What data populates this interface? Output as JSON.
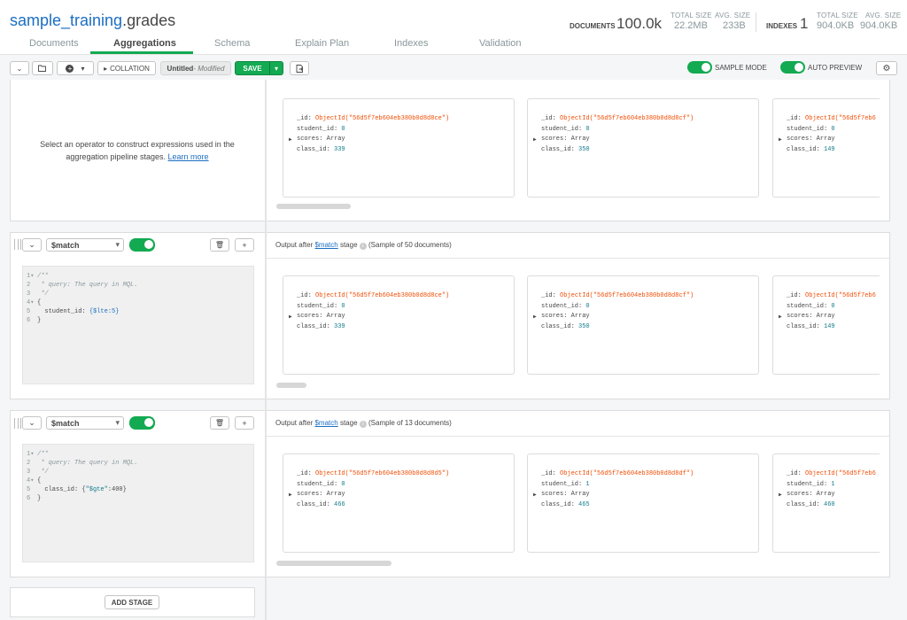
{
  "header": {
    "db": "sample_training",
    "collection": ".grades",
    "documents_label": "DOCUMENTS",
    "documents_value": "100.0k",
    "total_size_label": "TOTAL SIZE",
    "total_size_value": "22.2MB",
    "avg_size_label": "AVG. SIZE",
    "avg_size_value": "233B",
    "indexes_label": "INDEXES",
    "indexes_value": "1",
    "idx_total_size_label": "TOTAL SIZE",
    "idx_total_size_value": "904.0KB",
    "idx_avg_size_label": "AVG. SIZE",
    "idx_avg_size_value": "904.0KB"
  },
  "tabs": [
    "Documents",
    "Aggregations",
    "Schema",
    "Explain Plan",
    "Indexes",
    "Validation"
  ],
  "toolbar": {
    "collation": "COLLATION",
    "pipeline_name": "Untitled",
    "modified": "- Modified",
    "save": "SAVE",
    "sample_mode": "SAMPLE MODE",
    "auto_preview": "AUTO PREVIEW"
  },
  "first_stage": {
    "help": "Select an operator to construct expressions used in the aggregation pipeline stages.",
    "learn_more": "Learn more",
    "docs": [
      {
        "id": "ObjectId(\"56d5f7eb604eb380b0d8d8ce\")",
        "student_id": "0",
        "scores": "Array",
        "class_id": "339"
      },
      {
        "id": "ObjectId(\"56d5f7eb604eb380b0d8d8cf\")",
        "student_id": "0",
        "scores": "Array",
        "class_id": "350"
      },
      {
        "id": "ObjectId(\"56d5f7eb6",
        "student_id": "0",
        "scores": "Array",
        "class_id": "149"
      }
    ]
  },
  "stages": [
    {
      "operator": "$match",
      "output_prefix": "Output after",
      "output_op": "$match",
      "output_suffix": "stage",
      "sample": "(Sample of 50 documents)",
      "code": {
        "l1": "/**",
        "l2": " * query: The query in MQL.",
        "l3": " */",
        "l4": "{",
        "l5_key": "  student_id: ",
        "l5_val": "{$lte:5}",
        "l6": "}"
      },
      "docs": [
        {
          "id": "ObjectId(\"56d5f7eb604eb380b0d8d8ce\")",
          "student_id": "0",
          "scores": "Array",
          "class_id": "339"
        },
        {
          "id": "ObjectId(\"56d5f7eb604eb380b0d8d8cf\")",
          "student_id": "0",
          "scores": "Array",
          "class_id": "350"
        },
        {
          "id": "ObjectId(\"56d5f7eb6",
          "student_id": "0",
          "scores": "Array",
          "class_id": "149"
        }
      ]
    },
    {
      "operator": "$match",
      "output_prefix": "Output after",
      "output_op": "$match",
      "output_suffix": "stage",
      "sample": "(Sample of 13 documents)",
      "code": {
        "l1": "/**",
        "l2": " * query: The query in MQL.",
        "l3": " */",
        "l4": "{",
        "l5_key": "  class_id: {",
        "l5_val": "\"$gte\"",
        "l5_rest": ":400}",
        "l6": "}"
      },
      "docs": [
        {
          "id": "ObjectId(\"56d5f7eb604eb380b0d8d8d5\")",
          "student_id": "0",
          "scores": "Array",
          "class_id": "466"
        },
        {
          "id": "ObjectId(\"56d5f7eb604eb380b0d8d8df\")",
          "student_id": "1",
          "scores": "Array",
          "class_id": "465"
        },
        {
          "id": "ObjectId(\"56d5f7eb6",
          "student_id": "1",
          "scores": "Array",
          "class_id": "460"
        }
      ]
    }
  ],
  "add_stage": "ADD STAGE",
  "field_labels": {
    "id": "_id",
    "student_id": "student_id",
    "scores": "scores",
    "class_id": "class_id"
  },
  "colors": {
    "accent": "#13aa52",
    "link": "#1b6ec2",
    "oid": "#f04d05"
  },
  "icons": [
    "chevron-down-icon",
    "folder-open-icon",
    "plus-circle-icon",
    "caret-right-icon",
    "export-icon",
    "gear-icon",
    "trash-icon",
    "plus-icon",
    "drag-handle-icon",
    "info-icon"
  ]
}
